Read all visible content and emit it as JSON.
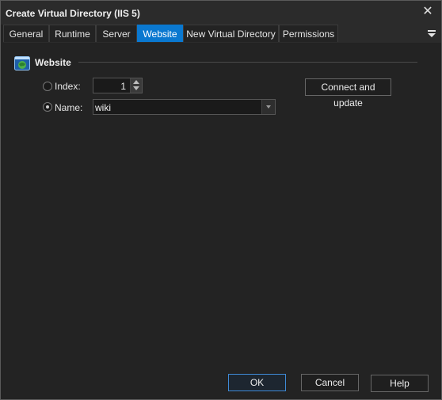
{
  "window": {
    "title": "Create Virtual Directory (IIS 5)"
  },
  "tabs": [
    {
      "label": "General"
    },
    {
      "label": "Runtime"
    },
    {
      "label": "Server"
    },
    {
      "label": "Website"
    },
    {
      "label": "New Virtual Directory"
    },
    {
      "label": "Permissions"
    }
  ],
  "group": {
    "title": "Website",
    "icon": "website-globe-icon"
  },
  "index": {
    "label": "Index:",
    "value": "1",
    "selected": false
  },
  "name": {
    "label": "Name:",
    "value": "wiki",
    "selected": true
  },
  "connect_button": {
    "label": "Connect and update"
  },
  "footer": {
    "ok_label": "OK",
    "cancel_label": "Cancel",
    "help_label": "Help"
  },
  "colors": {
    "accent": "#0a78d0",
    "background": "#232323"
  }
}
